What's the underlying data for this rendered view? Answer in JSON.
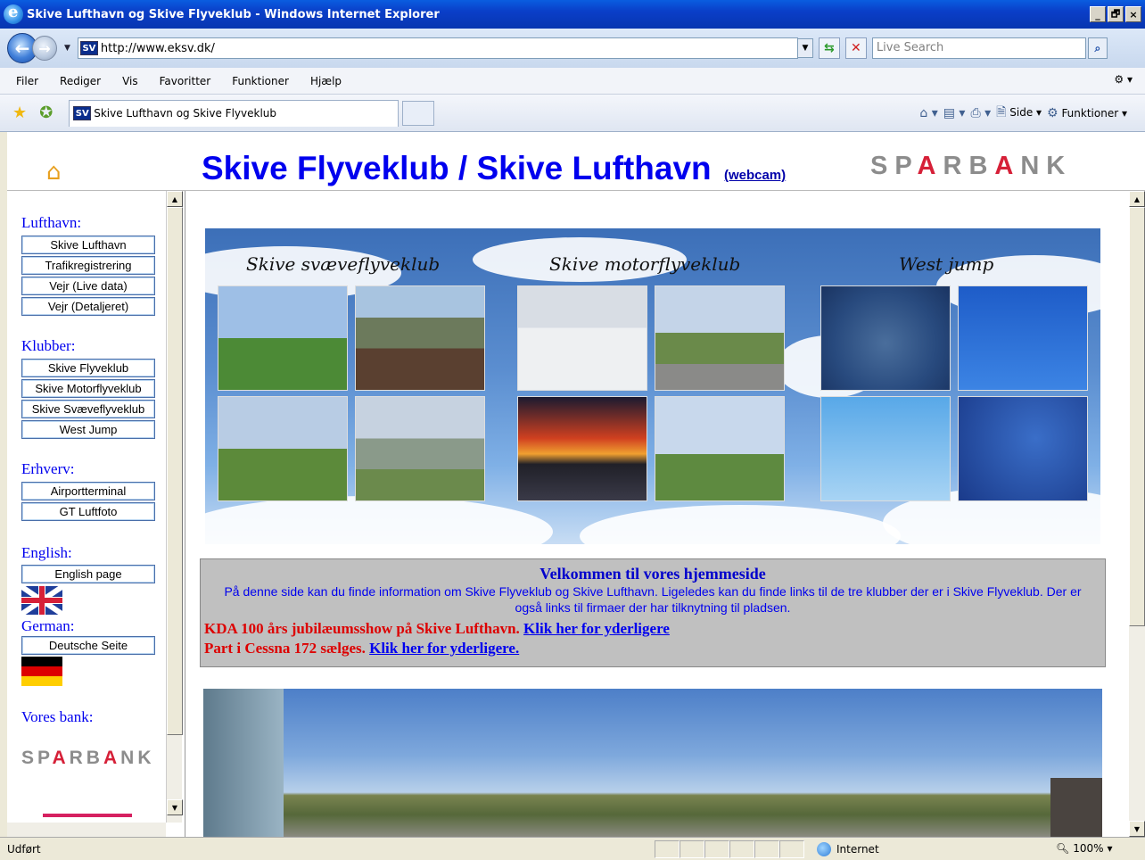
{
  "window": {
    "title": "Skive Lufthavn og Skive Flyveklub - Windows Internet Explorer",
    "controls": [
      "_",
      "🗗",
      "×"
    ]
  },
  "address": {
    "favicon_text": "SV",
    "url": "http://www.eksv.dk/",
    "search_placeholder": "Live Search"
  },
  "menu": {
    "items": [
      "Filer",
      "Rediger",
      "Vis",
      "Favoritter",
      "Funktioner",
      "Hjælp"
    ]
  },
  "tabs": {
    "active_title": "Skive Lufthavn og Skive Flyveklub"
  },
  "commandbar": {
    "side_label": "Side",
    "funktioner_label": "Funktioner"
  },
  "header": {
    "title": "Skive Flyveklub / Skive Lufthavn",
    "webcam_link": "(webcam)",
    "bank_logo": "SPARBANK"
  },
  "leftnav": {
    "sections": [
      {
        "heading": "Lufthavn:",
        "buttons": [
          "Skive Lufthavn",
          "Trafikregistrering",
          "Vejr (Live data)",
          "Vejr (Detaljeret)"
        ]
      },
      {
        "heading": "Klubber:",
        "buttons": [
          "Skive Flyveklub",
          "Skive Motorflyveklub",
          "Skive Svæveflyveklub",
          "West Jump"
        ]
      },
      {
        "heading": "Erhverv:",
        "buttons": [
          "Airportterminal",
          "GT Luftfoto"
        ]
      },
      {
        "heading": "English:",
        "buttons": [
          "English page"
        ]
      },
      {
        "heading": "German:",
        "buttons": [
          "Deutsche Seite"
        ]
      }
    ],
    "bank_heading": "Vores bank:",
    "bank_logo": "SPARBANK"
  },
  "collage": {
    "labels": [
      "Skive svæveflyveklub",
      "Skive motorflyveklub",
      "West jump"
    ]
  },
  "welcome": {
    "heading": "Velkommen til vores hjemmeside",
    "intro": "På denne side kan du finde information om Skive Flyveklub og Skive Lufthavn. Ligeledes kan du finde links til de tre klubber der er i Skive Flyveklub. Der er også links til firmaer der har tilknytning til pladsen.",
    "news": [
      {
        "text": "KDA 100 års jubilæumsshow på Skive Lufthavn.",
        "link": "Klik her for yderligere"
      },
      {
        "text": "Part i Cessna 172 sælges.",
        "link": "Klik her for yderligere."
      }
    ]
  },
  "status": {
    "text": "Udført",
    "zone": "Internet",
    "zoom": "100%"
  }
}
